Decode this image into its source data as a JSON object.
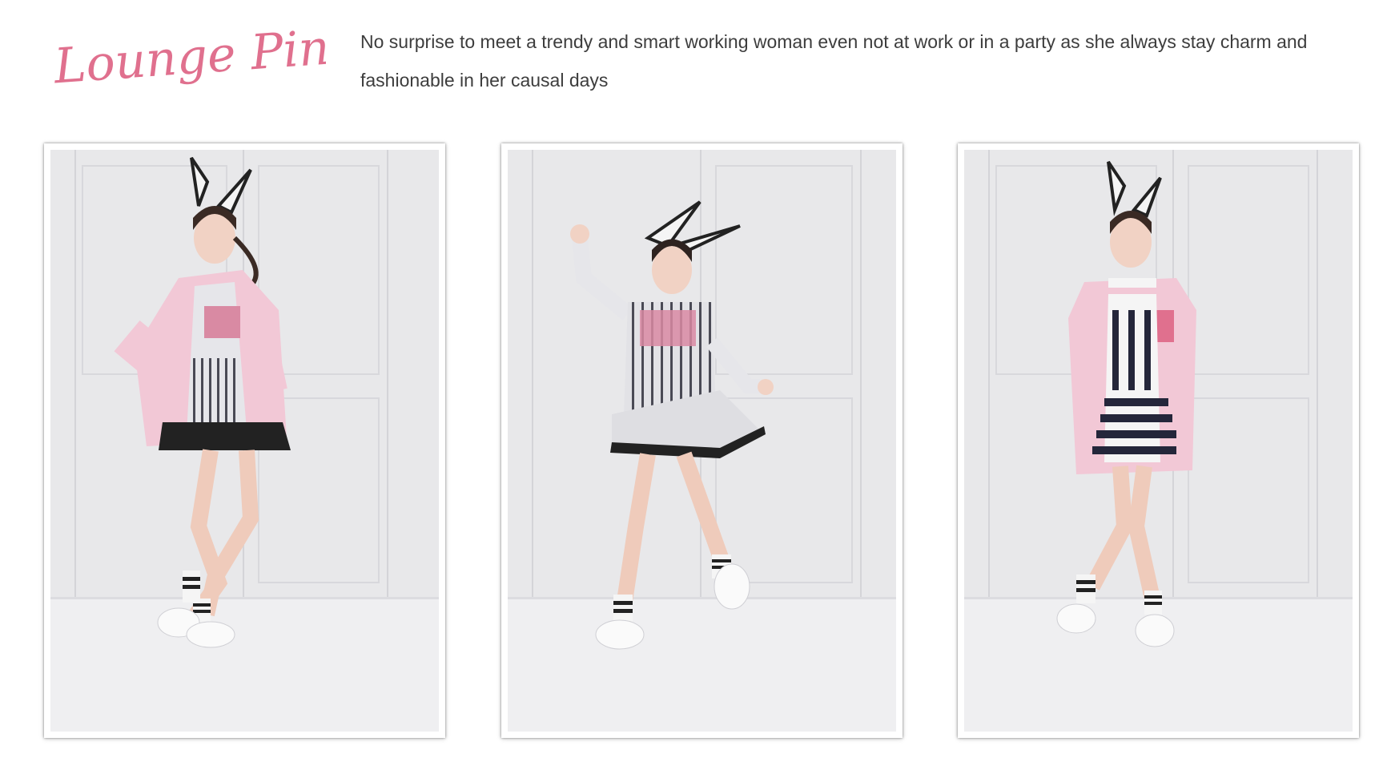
{
  "brand": {
    "logo_text": "Lounge Pink",
    "logo_color": "#e0708e"
  },
  "tagline": {
    "text": "No surprise to meet a trendy and smart working woman even not at work or in a party as she always stay charm and fashionable in her causal days"
  },
  "gallery": {
    "photos": [
      {
        "subject": "model-pink-blazer-striped-dress"
      },
      {
        "subject": "model-striped-long-sleeve-dress"
      },
      {
        "subject": "model-pink-varsity-jacket-striped-dress"
      }
    ]
  },
  "colors": {
    "text": "#3d3d3d",
    "backdrop": "#e9e9eb",
    "pink": "#f2c8d6",
    "stripe_dark": "#24263a"
  }
}
